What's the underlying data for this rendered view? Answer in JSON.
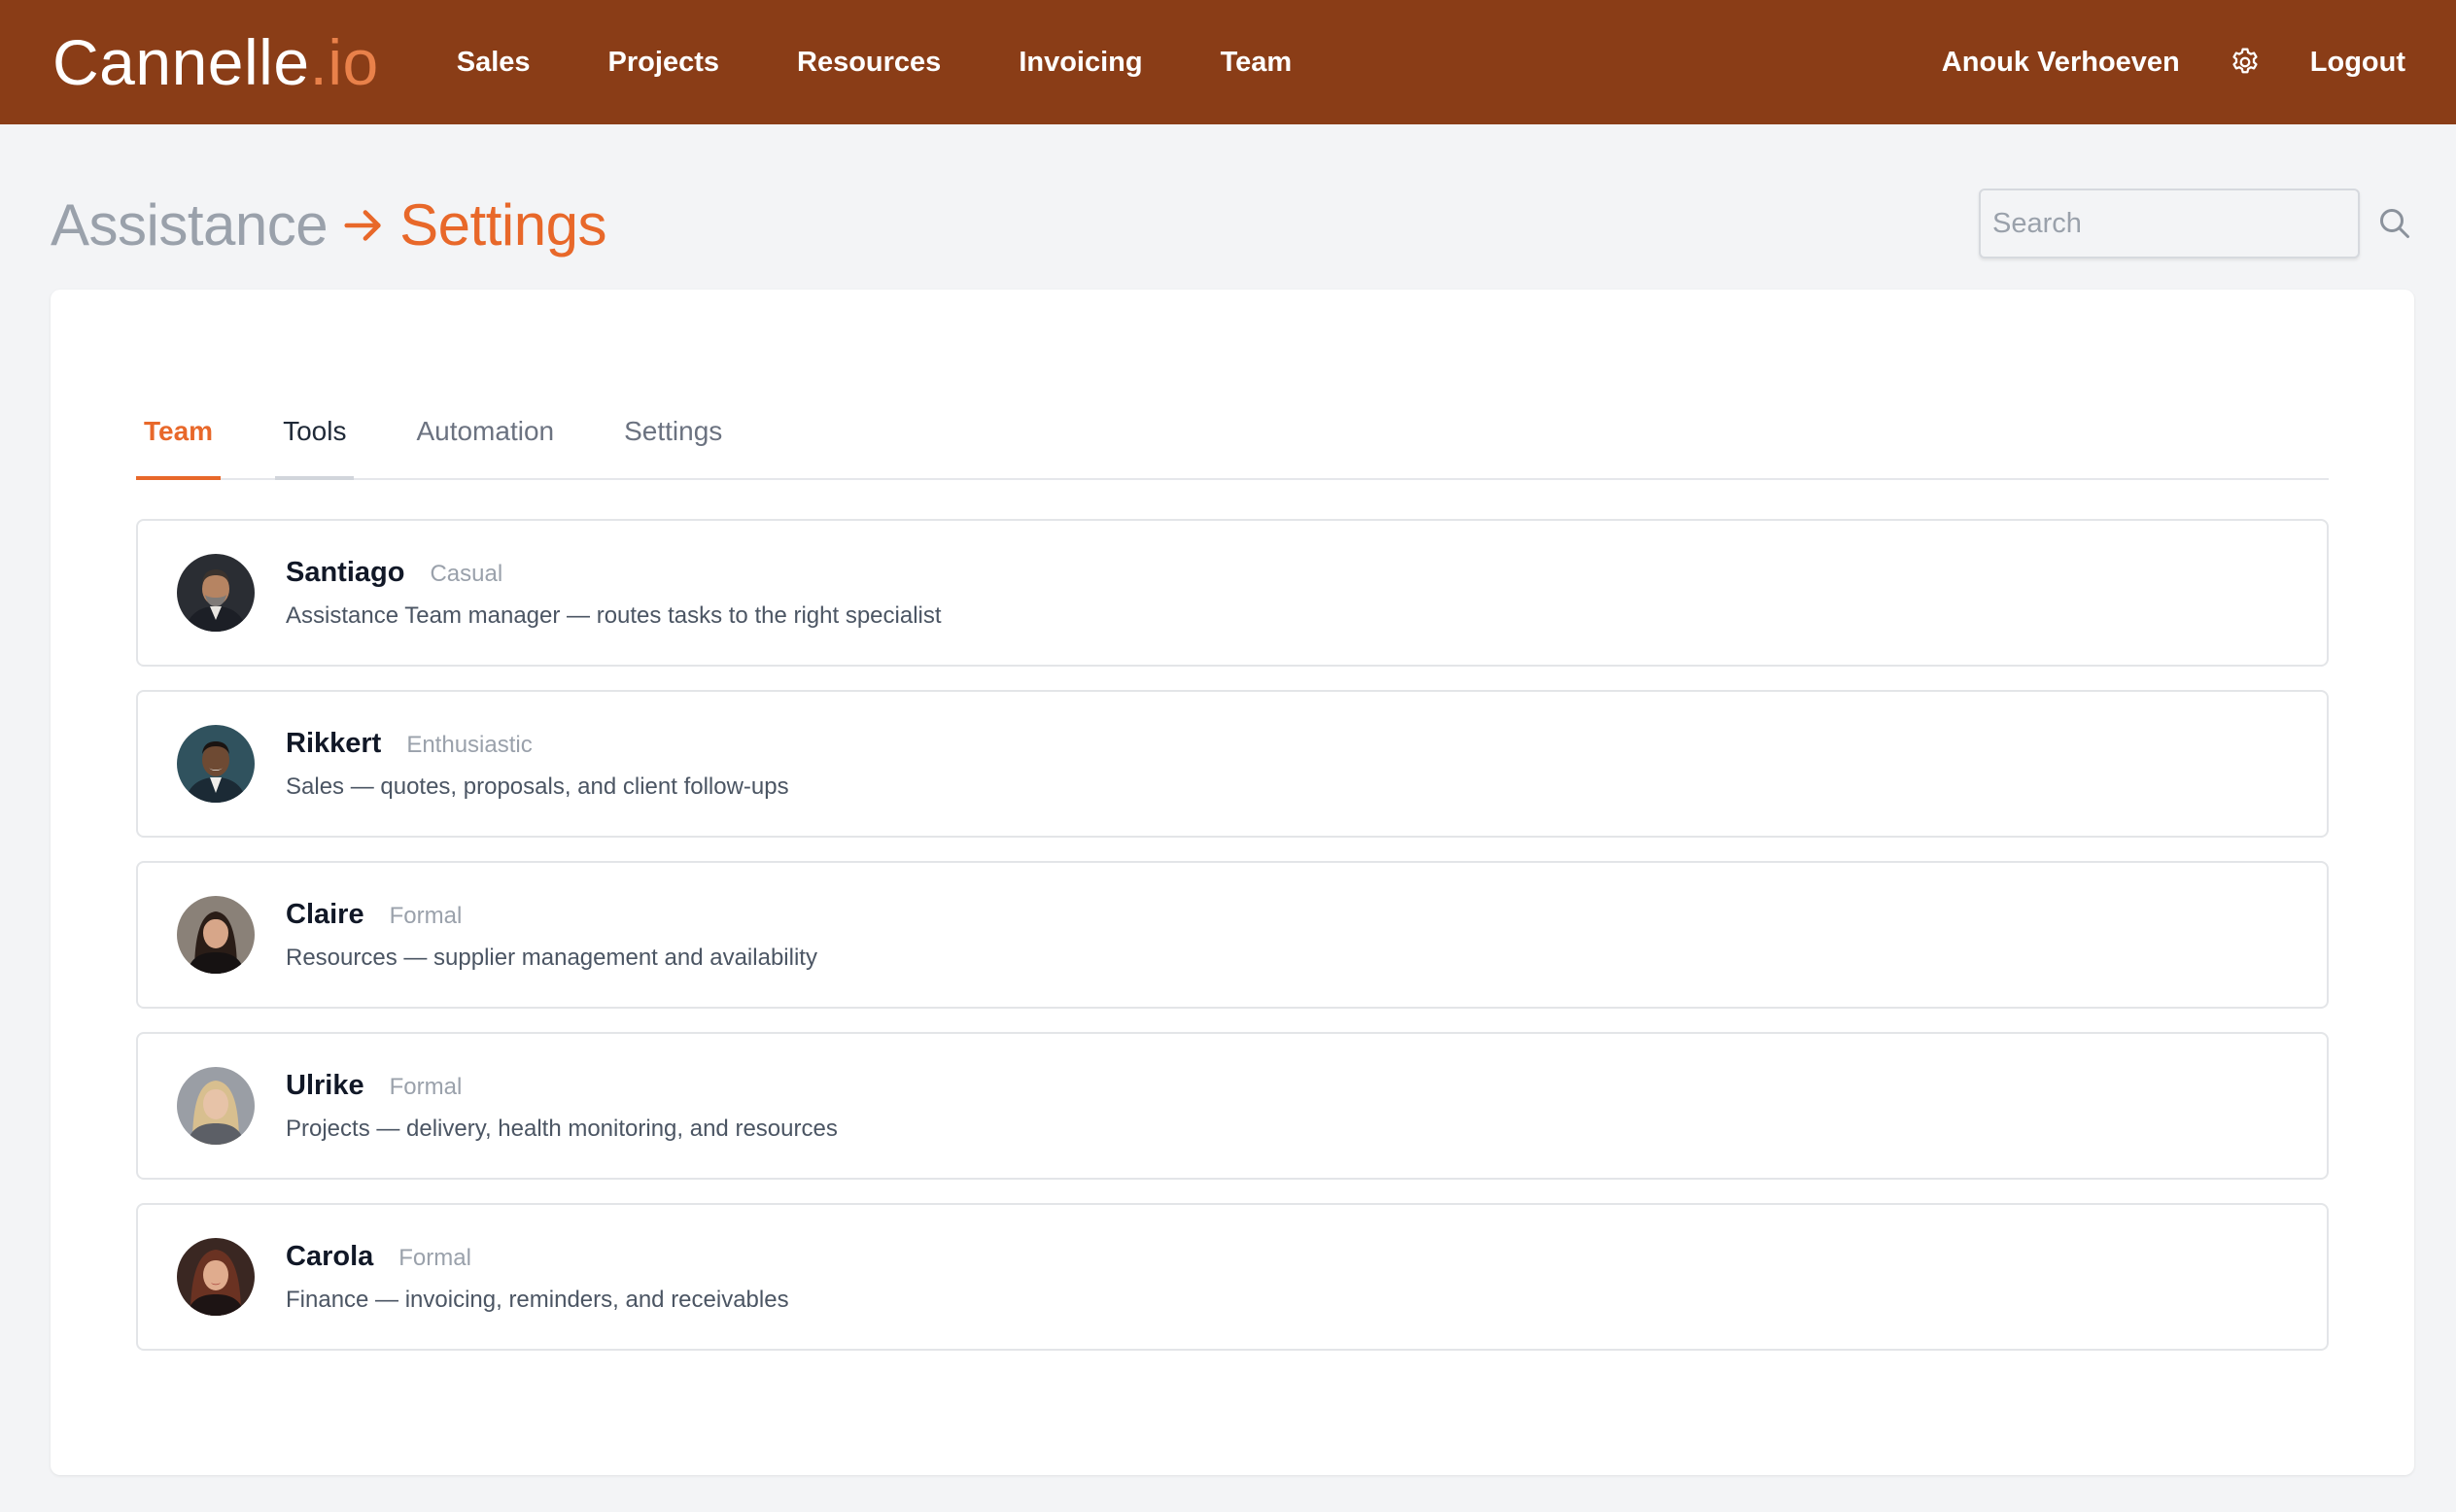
{
  "brand": {
    "name": "Cannelle",
    "suffix": ".io"
  },
  "nav": {
    "items": [
      {
        "label": "Sales"
      },
      {
        "label": "Projects"
      },
      {
        "label": "Resources"
      },
      {
        "label": "Invoicing"
      },
      {
        "label": "Team"
      }
    ],
    "user_name": "Anouk Verhoeven",
    "settings_icon": "gear-icon",
    "logout_label": "Logout"
  },
  "page": {
    "breadcrumb_parent": "Assistance",
    "breadcrumb_separator_icon": "arrow-right-icon",
    "breadcrumb_current": "Settings"
  },
  "search": {
    "placeholder": "Search",
    "value": "",
    "icon": "search-icon"
  },
  "tabs": [
    {
      "label": "Team",
      "state": "active"
    },
    {
      "label": "Tools",
      "state": "hover"
    },
    {
      "label": "Automation",
      "state": "default"
    },
    {
      "label": "Settings",
      "state": "default"
    }
  ],
  "members": [
    {
      "name": "Santiago",
      "tone": "Casual",
      "description": "Assistance Team manager — routes tasks to the right specialist"
    },
    {
      "name": "Rikkert",
      "tone": "Enthusiastic",
      "description": "Sales — quotes, proposals, and client follow-ups"
    },
    {
      "name": "Claire",
      "tone": "Formal",
      "description": "Resources — supplier management and availability"
    },
    {
      "name": "Ulrike",
      "tone": "Formal",
      "description": "Projects — delivery, health monitoring, and resources"
    },
    {
      "name": "Carola",
      "tone": "Formal",
      "description": "Finance — invoicing, reminders, and receivables"
    }
  ],
  "colors": {
    "header_bg": "#8a3d17",
    "accent": "#e8682a",
    "brand_suffix": "#e9814a",
    "page_bg": "#f3f4f6",
    "muted_text": "#9aa1ab"
  }
}
